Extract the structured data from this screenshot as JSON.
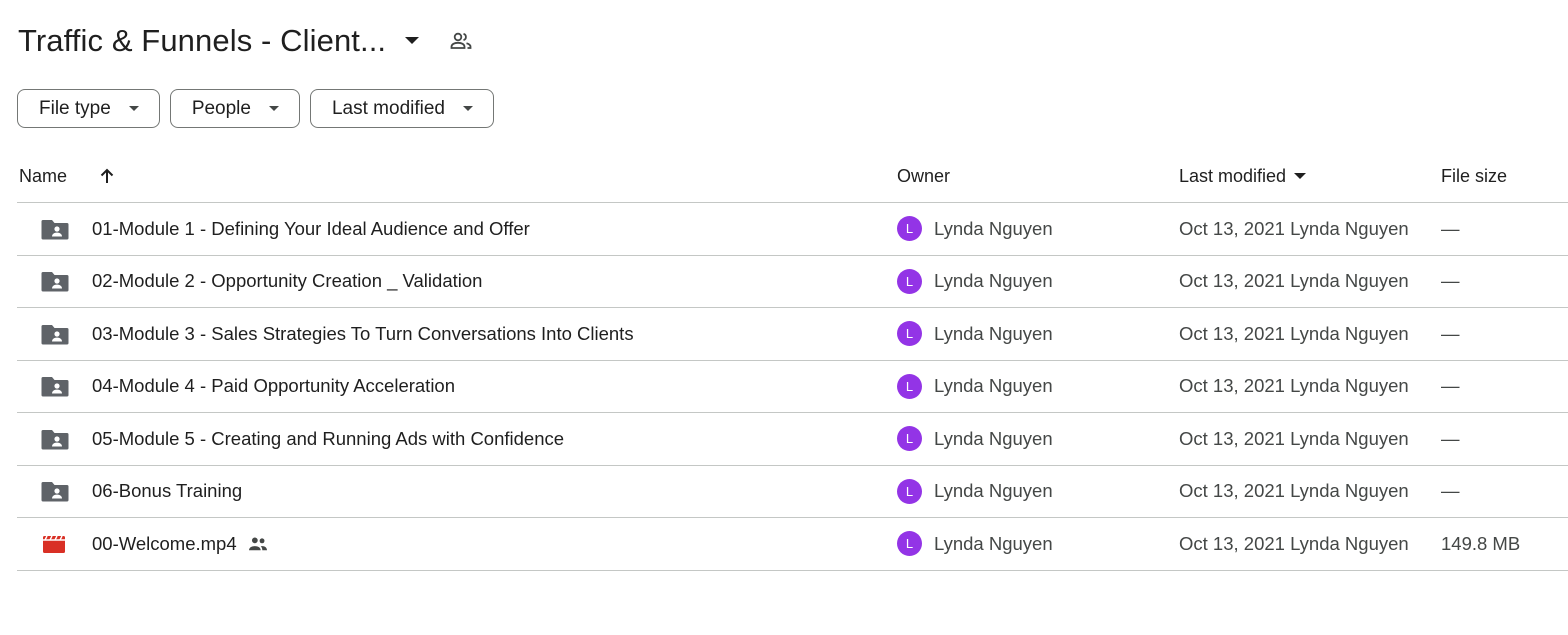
{
  "header": {
    "title": "Traffic & Funnels - Client...",
    "title_icon": "arrow-drop-down-icon",
    "shared_icon": "people-outline-icon"
  },
  "filters": [
    {
      "label": "File type"
    },
    {
      "label": "People"
    },
    {
      "label": "Last modified"
    }
  ],
  "columns": {
    "name": "Name",
    "owner": "Owner",
    "last_modified": "Last modified",
    "file_size": "File size"
  },
  "rows": [
    {
      "icon": "shared-folder-icon",
      "name": "01-Module 1 - Defining Your Ideal Audience and Offer",
      "owner_initial": "L",
      "owner": "Lynda Nguyen",
      "modified": "Oct 13, 2021 Lynda Nguyen",
      "size": "—"
    },
    {
      "icon": "shared-folder-icon",
      "name": "02-Module 2 - Opportunity Creation _ Validation",
      "owner_initial": "L",
      "owner": "Lynda Nguyen",
      "modified": "Oct 13, 2021 Lynda Nguyen",
      "size": "—"
    },
    {
      "icon": "shared-folder-icon",
      "name": "03-Module 3 - Sales Strategies To Turn Conversations Into Clients",
      "owner_initial": "L",
      "owner": "Lynda Nguyen",
      "modified": "Oct 13, 2021 Lynda Nguyen",
      "size": "—"
    },
    {
      "icon": "shared-folder-icon",
      "name": "04-Module 4 - Paid Opportunity Acceleration",
      "owner_initial": "L",
      "owner": "Lynda Nguyen",
      "modified": "Oct 13, 2021 Lynda Nguyen",
      "size": "—"
    },
    {
      "icon": "shared-folder-icon",
      "name": "05-Module 5 - Creating and Running Ads with Confidence",
      "owner_initial": "L",
      "owner": "Lynda Nguyen",
      "modified": "Oct 13, 2021 Lynda Nguyen",
      "size": "—"
    },
    {
      "icon": "shared-folder-icon",
      "name": "06-Bonus Training",
      "owner_initial": "L",
      "owner": "Lynda Nguyen",
      "modified": "Oct 13, 2021 Lynda Nguyen",
      "size": "—"
    },
    {
      "icon": "video-file-icon",
      "name": "00-Welcome.mp4",
      "shared": true,
      "owner_initial": "L",
      "owner": "Lynda Nguyen",
      "modified": "Oct 13, 2021 Lynda Nguyen",
      "size": "149.8 MB"
    }
  ],
  "colors": {
    "avatar": "#9334e6",
    "folder_icon": "#5f6368",
    "video_icon": "#d93025",
    "divider": "#c4c7c5"
  }
}
